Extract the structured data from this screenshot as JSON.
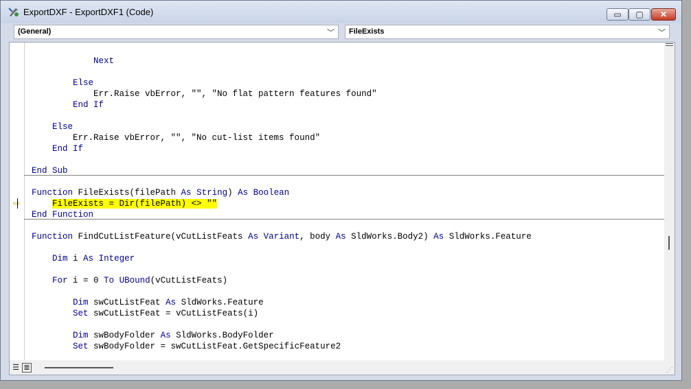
{
  "window": {
    "title": "ExportDXF - ExportDXF1 (Code)",
    "controls": {
      "minimize": "▭",
      "maximize": "▢",
      "close": "✕"
    }
  },
  "object_combo": {
    "value": "(General)"
  },
  "procedure_combo": {
    "value": "FileExists"
  },
  "code_lines": [
    [
      {
        "t": "            "
      },
      {
        "t": "Next",
        "k": 1
      }
    ],
    [],
    [
      {
        "t": "        "
      },
      {
        "t": "Else",
        "k": 1
      }
    ],
    [
      {
        "t": "            Err.Raise vbError, \"\", \"No flat pattern features found\""
      }
    ],
    [
      {
        "t": "        "
      },
      {
        "t": "End If",
        "k": 1
      }
    ],
    [],
    [
      {
        "t": "    "
      },
      {
        "t": "Else",
        "k": 1
      }
    ],
    [
      {
        "t": "        Err.Raise vbError, \"\", \"No cut-list items found\""
      }
    ],
    [
      {
        "t": "    "
      },
      {
        "t": "End If",
        "k": 1
      }
    ],
    [],
    [
      {
        "t": "End Sub",
        "k": 1
      }
    ],
    [],
    [
      {
        "t": "Function",
        "k": 1
      },
      {
        "t": " FileExists(filePath "
      },
      {
        "t": "As",
        "k": 1
      },
      {
        "t": " "
      },
      {
        "t": "String",
        "k": 1
      },
      {
        "t": ") "
      },
      {
        "t": "As",
        "k": 1
      },
      {
        "t": " "
      },
      {
        "t": "Boolean",
        "k": 1
      }
    ],
    [
      {
        "t": "    "
      },
      {
        "t": "FileExists = Dir(filePath) <> \"\"",
        "h": 1
      }
    ],
    [
      {
        "t": "End Function",
        "k": 1
      }
    ],
    [],
    [
      {
        "t": "Function",
        "k": 1
      },
      {
        "t": " FindCutListFeature(vCutListFeats "
      },
      {
        "t": "As",
        "k": 1
      },
      {
        "t": " "
      },
      {
        "t": "Variant",
        "k": 1
      },
      {
        "t": ", body "
      },
      {
        "t": "As",
        "k": 1
      },
      {
        "t": " SldWorks.Body2) "
      },
      {
        "t": "As",
        "k": 1
      },
      {
        "t": " SldWorks.Feature"
      }
    ],
    [],
    [
      {
        "t": "    "
      },
      {
        "t": "Dim",
        "k": 1
      },
      {
        "t": " i "
      },
      {
        "t": "As",
        "k": 1
      },
      {
        "t": " "
      },
      {
        "t": "Integer",
        "k": 1
      }
    ],
    [],
    [
      {
        "t": "    "
      },
      {
        "t": "For",
        "k": 1
      },
      {
        "t": " i = 0 "
      },
      {
        "t": "To",
        "k": 1
      },
      {
        "t": " "
      },
      {
        "t": "UBound",
        "k": 1
      },
      {
        "t": "(vCutListFeats)"
      }
    ],
    [],
    [
      {
        "t": "        "
      },
      {
        "t": "Dim",
        "k": 1
      },
      {
        "t": " swCutListFeat "
      },
      {
        "t": "As",
        "k": 1
      },
      {
        "t": " SldWorks.Feature"
      }
    ],
    [
      {
        "t": "        "
      },
      {
        "t": "Set",
        "k": 1
      },
      {
        "t": " swCutListFeat = vCutListFeats(i)"
      }
    ],
    [],
    [
      {
        "t": "        "
      },
      {
        "t": "Dim",
        "k": 1
      },
      {
        "t": " swBodyFolder "
      },
      {
        "t": "As",
        "k": 1
      },
      {
        "t": " SldWorks.BodyFolder"
      }
    ],
    [
      {
        "t": "        "
      },
      {
        "t": "Set",
        "k": 1
      },
      {
        "t": " swBodyFolder = swCutListFeat.GetSpecificFeature2"
      }
    ]
  ],
  "icons": {
    "app": "vba-editor-icon",
    "execution": "current-line-arrow-icon",
    "procedure_view": "procedure-view-icon",
    "full_module_view": "full-module-view-icon"
  }
}
